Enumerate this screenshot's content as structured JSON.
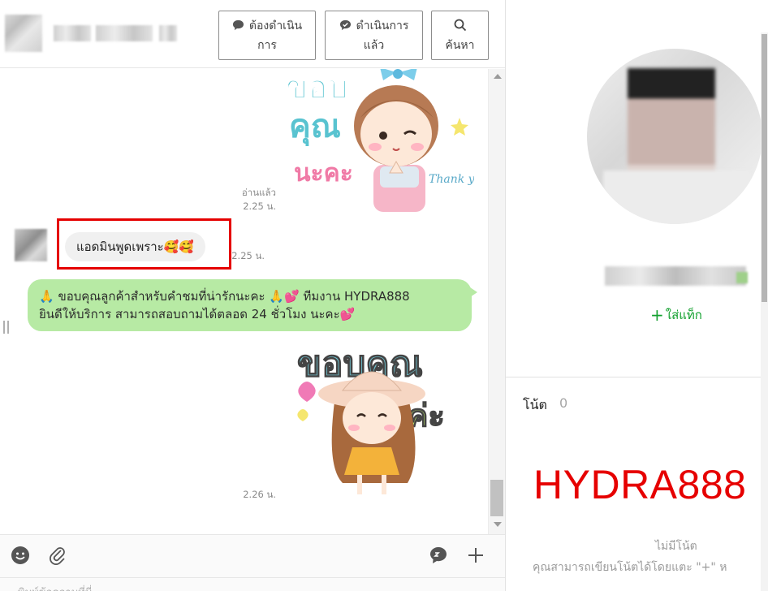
{
  "header": {
    "buttons": [
      {
        "line1": "ต้องดำเนิน",
        "line2": "การ",
        "icon": "speech-bubble-icon"
      },
      {
        "line1": "ดำเนินการ",
        "line2": "แล้ว",
        "icon": "check-bubble-icon"
      },
      {
        "line1": "",
        "line2": "ค้นหา",
        "icon": "search-icon"
      }
    ]
  },
  "messages": {
    "sticker1_meta": {
      "status": "อ่านแล้ว",
      "time": "2.25 น."
    },
    "incoming": {
      "text": "แอดมินพูดเพราะ🥰🥰",
      "time": "2.25 น."
    },
    "outgoing": {
      "line1": "🙏 ขอบคุณลูกค้าสำหรับคำชมที่น่ารักนะคะ 🙏💕 ทีมงาน HYDRA888",
      "line2": "ยินดีให้บริการ สามารถสอบถามได้ตลอด 24 ชั่วโมง นะคะ💕"
    },
    "sticker2_meta": {
      "time": "2.26 น."
    },
    "stickers": [
      {
        "text_lines": [
          "ขอบ",
          "คุณ",
          "นะคะ"
        ],
        "thank_you": "Thank you",
        "icon": "thank-you-girl-sticker"
      },
      {
        "text_lines": [
          "ขอบคุณ",
          "ค่ะ"
        ],
        "icon": "thank-you-hat-girl-sticker"
      }
    ]
  },
  "composer": {
    "placeholder": "พิมพ์ข้อความที่นี่",
    "tools": [
      "emoji-icon",
      "attachment-icon",
      "chat-icon",
      "plus-icon"
    ]
  },
  "profile": {
    "add_tag": "ใส่แท็ก",
    "notes_title": "โน้ต",
    "notes_count": "0",
    "overlay_text": "HYDRA888",
    "no_notes": "ไม่มีโน้ต",
    "no_notes_hint": "คุณสามารถเขียนโน้ตได้โดยแตะ \"+\" ห"
  },
  "colors": {
    "outgoing_bubble": "#b7eaa4",
    "incoming_bubble": "#f0f0f0",
    "highlight": "#e50000",
    "brand_text": "#e60000",
    "tag_green": "#12a02e"
  }
}
